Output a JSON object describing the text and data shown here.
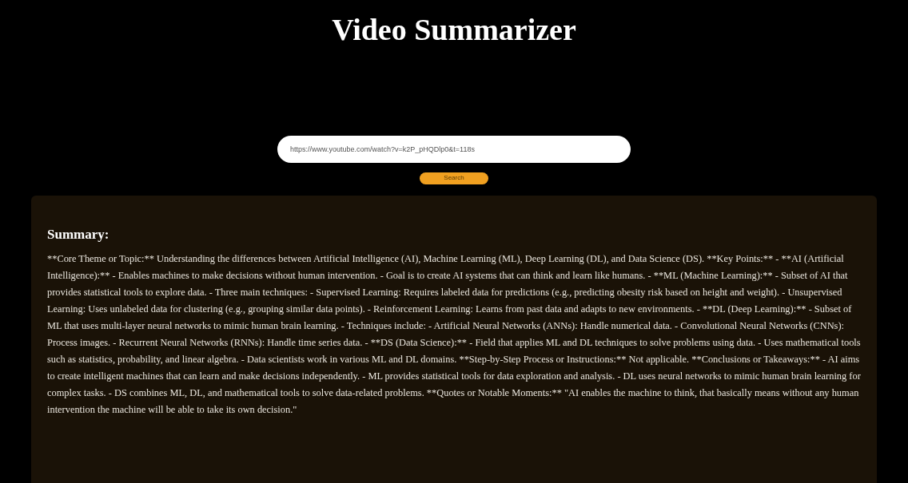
{
  "title": "Video Summarizer",
  "url_field": {
    "value": "https://www.youtube.com/watch?v=k2P_pHQDlp0&t=118s"
  },
  "search_button": "Search",
  "summary": {
    "heading": "Summary:",
    "text": "**Core Theme or Topic:** Understanding the differences between Artificial Intelligence (AI), Machine Learning (ML), Deep Learning (DL), and Data Science (DS). **Key Points:** - **AI (Artificial Intelligence):** - Enables machines to make decisions without human intervention. - Goal is to create AI systems that can think and learn like humans. - **ML (Machine Learning):** - Subset of AI that provides statistical tools to explore data. - Three main techniques: - Supervised Learning: Requires labeled data for predictions (e.g., predicting obesity risk based on height and weight). - Unsupervised Learning: Uses unlabeled data for clustering (e.g., grouping similar data points). - Reinforcement Learning: Learns from past data and adapts to new environments. - **DL (Deep Learning):** - Subset of ML that uses multi-layer neural networks to mimic human brain learning. - Techniques include: - Artificial Neural Networks (ANNs): Handle numerical data. - Convolutional Neural Networks (CNNs): Process images. - Recurrent Neural Networks (RNNs): Handle time series data. - **DS (Data Science):** - Field that applies ML and DL techniques to solve problems using data. - Uses mathematical tools such as statistics, probability, and linear algebra. - Data scientists work in various ML and DL domains. **Step-by-Step Process or Instructions:** Not applicable. **Conclusions or Takeaways:** - AI aims to create intelligent machines that can learn and make decisions independently. - ML provides statistical tools for data exploration and analysis. - DL uses neural networks to mimic human brain learning for complex tasks. - DS combines ML, DL, and mathematical tools to solve data-related problems. **Quotes or Notable Moments:** \"AI enables the machine to think, that basically means without any human intervention the machine will be able to take its own decision.\""
  }
}
